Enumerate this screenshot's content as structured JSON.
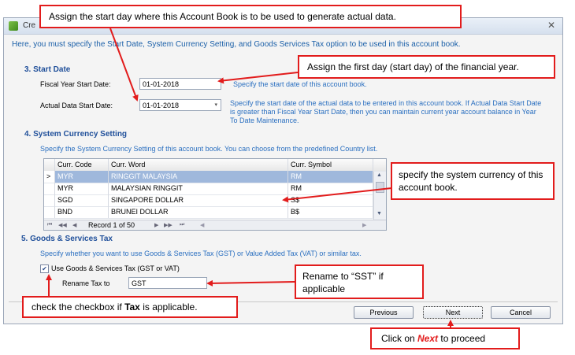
{
  "window": {
    "title": "Cre",
    "close_glyph": "✕",
    "intro": "Here, you must specify the Start Date, System Currency Setting, and Goods  Services Tax option to be used in this account book."
  },
  "start_date": {
    "section_title": "3. Start Date",
    "fiscal_label": "Fiscal Year Start Date:",
    "fiscal_value": "01-01-2018",
    "fiscal_help": "Specify the start date of this account book.",
    "actual_label": "Actual Data Start Date:",
    "actual_value": "01-01-2018",
    "actual_help": "Specify the start date of the actual data to be entered in this account book. If Actual Data Start Date is greater than Fiscal Year Start Date, then you can maintain current year account balance in Year To Date Maintenance."
  },
  "currency": {
    "section_title": "4. System Currency Setting",
    "help": "Specify the System Currency Setting of this account book. You can choose from the predefined Country list.",
    "columns": [
      "Curr. Code",
      "Curr. Word",
      "Curr. Symbol"
    ],
    "rows": [
      {
        "indicator": ">",
        "code": "MYR",
        "word": "RINGGIT MALAYSIA",
        "symbol": "RM"
      },
      {
        "indicator": "",
        "code": "MYR",
        "word": "MALAYSIAN RINGGIT",
        "symbol": "RM"
      },
      {
        "indicator": "",
        "code": "SGD",
        "word": "SINGAPORE DOLLAR",
        "symbol": "S$"
      },
      {
        "indicator": "",
        "code": "BND",
        "word": "BRUNEI DOLLAR",
        "symbol": "B$"
      }
    ],
    "nav_first": "⏮",
    "nav_prev_page": "◀◀",
    "nav_prev": "◀",
    "record_text": "Record 1 of 50",
    "nav_next": "▶",
    "nav_next_page": "▶▶",
    "nav_last": "⏭",
    "scroll_up": "▲",
    "scroll_down": "▼",
    "hscroll_left": "◀",
    "hscroll_right": "▶"
  },
  "tax": {
    "section_title": "5. Goods & Services Tax",
    "help": "Specify whether you want to use Goods & Services Tax (GST) or Value Added Tax (VAT) or similar tax.",
    "checkbox_label": "Use Goods & Services Tax (GST or VAT)",
    "checkbox_checked": true,
    "checkmark": "✔",
    "rename_label": "Rename Tax to",
    "rename_value": "GST"
  },
  "buttons": {
    "previous": "Previous",
    "next": "Next",
    "cancel": "Cancel"
  },
  "callouts": {
    "start_day": "Assign the start day where this Account Book is to be used to generate actual data.",
    "first_day": "Assign the first day (start day) of the financial year.",
    "currency": "specify the system currency of this account book.",
    "rename": "Rename to “SST” if applicable",
    "checkbox_prefix": "check the checkbox if ",
    "checkbox_bold": "Tax",
    "checkbox_suffix": " is applicable.",
    "next_prefix": "Click on ",
    "next_bold": "Next",
    "next_suffix": " to proceed"
  },
  "colors": {
    "accent_blue": "#1f4f9a",
    "help_blue": "#2a6fc0",
    "callout_red": "#e21c1c",
    "selected_row": "#9fb8dc"
  }
}
